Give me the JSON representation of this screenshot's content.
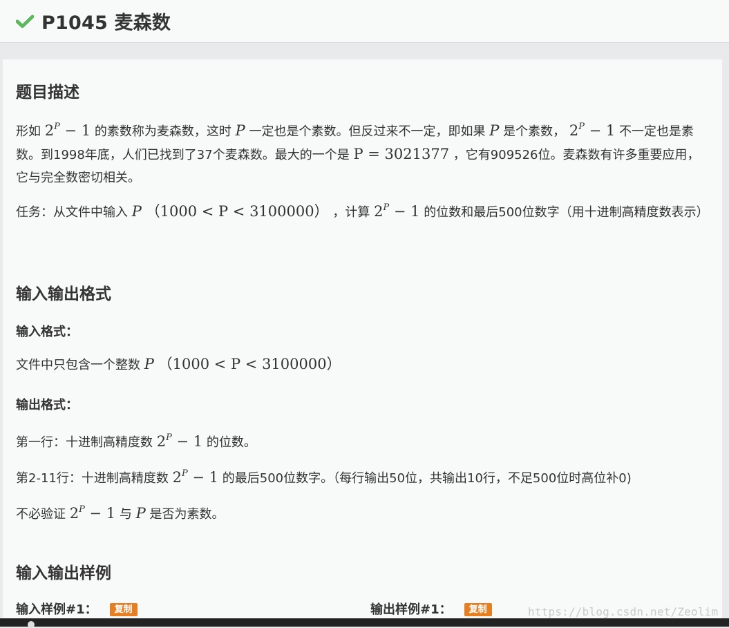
{
  "header": {
    "icon": "check-icon",
    "title": "P1045 麦森数",
    "check_color": "#5cb85c"
  },
  "sections": {
    "description": {
      "heading": "题目描述",
      "p1": {
        "a": "形如",
        "b": "的素数称为麦森数，这时",
        "c": "一定也是个素数。但反过来不一定，即如果",
        "d": "是个素数，",
        "e": "不一定也是素数。到1998年底，人们已找到了37个麦森数。最大的一个是",
        "f": "，它有909526位。麦森数有许多重要应用，它与完全数密切相关。"
      },
      "p2": {
        "a": "任务：从文件中输入",
        "b": "，计算",
        "c": "的位数和最后500位数字（用十进制高精度数表示）"
      }
    },
    "io_format": {
      "heading": "输入输出格式",
      "input_label": "输入格式：",
      "input_text": "文件中只包含一个整数",
      "output_label": "输出格式：",
      "line1": {
        "a": "第一行：十进制高精度数",
        "b": "的位数。"
      },
      "line2": {
        "a": "第2-11行：十进制高精度数",
        "b": "的最后500位数字。（每行输出50位，共输出10行，不足500位时高位补0)"
      },
      "line3": {
        "a": "不必验证",
        "b": "与",
        "c": "是否为素数。"
      }
    },
    "samples": {
      "heading": "输入输出样例",
      "input_label": "输入样例#1：",
      "output_label": "输出样例#1：",
      "copy_label": "复制"
    }
  },
  "math": {
    "base": "2",
    "exp": "P",
    "minus_one": " − 1",
    "var": "P",
    "p_value": "P = 3021377",
    "range": "（1000 < P < 3100000）"
  },
  "watermark": "https://blog.csdn.net/Zeolim",
  "colors": {
    "accent": "#e67e22",
    "text": "#333333",
    "background": "#f8f9f9"
  }
}
